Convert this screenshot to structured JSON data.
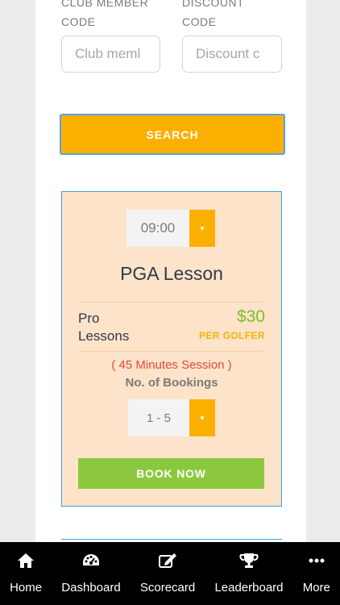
{
  "fields": {
    "club_member": {
      "label_line1": "CLUB MEMBER",
      "label_line2": "CODE",
      "placeholder": "Club meml"
    },
    "discount": {
      "label_line1": "DISCOUNT",
      "label_line2": "CODE",
      "placeholder": "Discount c"
    }
  },
  "search_label": "SEARCH",
  "lesson": {
    "time": "09:00",
    "title": "PGA Lesson",
    "pro_label": "Pro Lessons",
    "price": "$30",
    "per_golfer": "PER GOLFER",
    "session": "( 45 Minutes Session )",
    "bookings_label": "No. of Bookings",
    "bookings_value": "1 - 5",
    "book_label": "BOOK NOW"
  },
  "tabs": [
    {
      "label": "Home",
      "icon": "home-icon"
    },
    {
      "label": "Dashboard",
      "icon": "dashboard-icon"
    },
    {
      "label": "Scorecard",
      "icon": "scorecard-icon"
    },
    {
      "label": "Leaderboard",
      "icon": "trophy-icon"
    },
    {
      "label": "More",
      "icon": "more-icon"
    }
  ],
  "colors": {
    "accent": "#fbb001",
    "book": "#8cc83f",
    "price": "#7bbf2a",
    "session": "#e2493b",
    "card_bg": "#fde3c9",
    "card_border": "#37a4d8"
  }
}
